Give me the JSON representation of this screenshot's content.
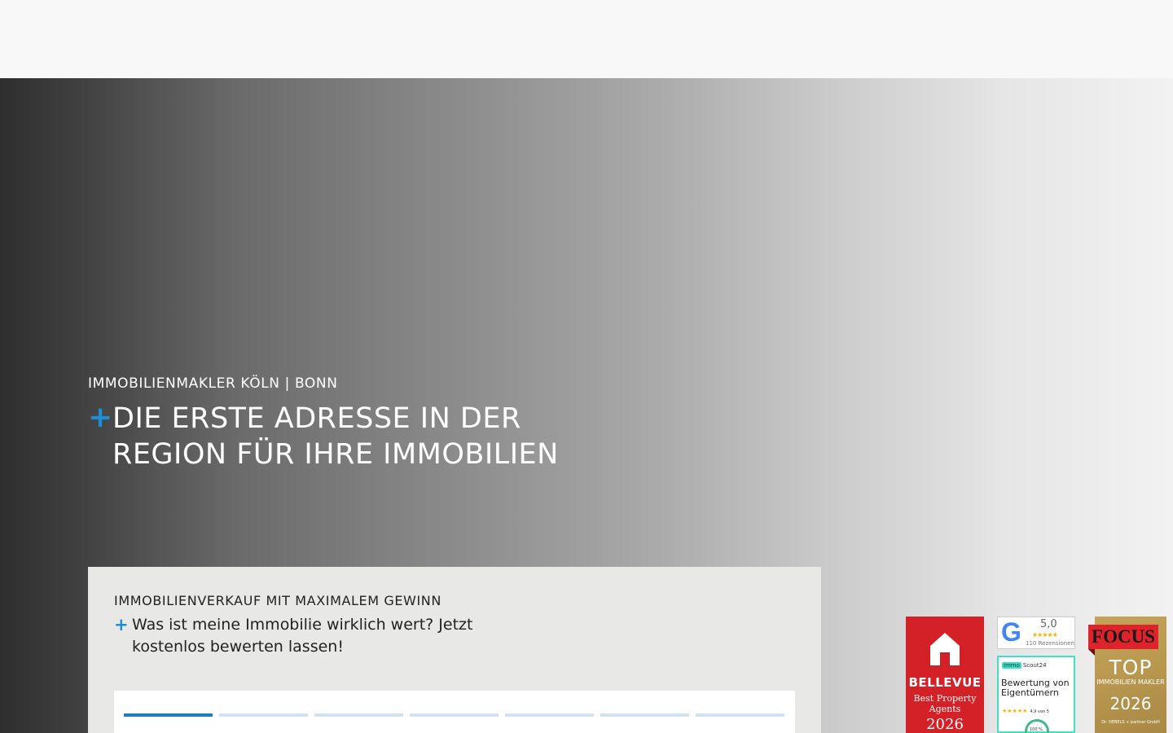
{
  "hero": {
    "eyebrow": "IMMOBILIENMAKLER KÖLN | BONN",
    "plus": "+",
    "title_line1": "DIE ERSTE ADRESSE IN DER",
    "title_line2": "REGION FÜR IHRE IMMOBILIEN"
  },
  "card": {
    "eyebrow": "IMMOBILIENVERKAUF MIT MAXIMALEM GEWINN",
    "plus": "+",
    "lead": "Was ist meine Immobilie wirklich wert? Jetzt kostenlos bewerten lassen!",
    "steps_total": 7,
    "steps_active": 1
  },
  "badges": {
    "bellevue": {
      "name": "BELLEVUE",
      "sub": "Best Property Agents",
      "year": "2026"
    },
    "google": {
      "letter": "G",
      "score": "5,0",
      "stars": "★★★★★",
      "reviews": "110 Rezensionen"
    },
    "scout": {
      "chip": "immo",
      "brand": "Scout24",
      "text": "Bewertung von Eigentümern",
      "stars": "★★★★★",
      "rating": "4,9 von 5",
      "pct": "100 %"
    },
    "focus": {
      "brand": "FOCUS",
      "top": "TOP",
      "sub": "IMMOBILIEN MAKLER",
      "year": "2026",
      "foot": "Dr. OEBELS + partner GmbH"
    }
  },
  "colors": {
    "accent": "#1a8fd6",
    "bellevue_red": "#d42027",
    "focus_gold": "#c5a45a",
    "scout_teal": "#3fe0c5"
  }
}
